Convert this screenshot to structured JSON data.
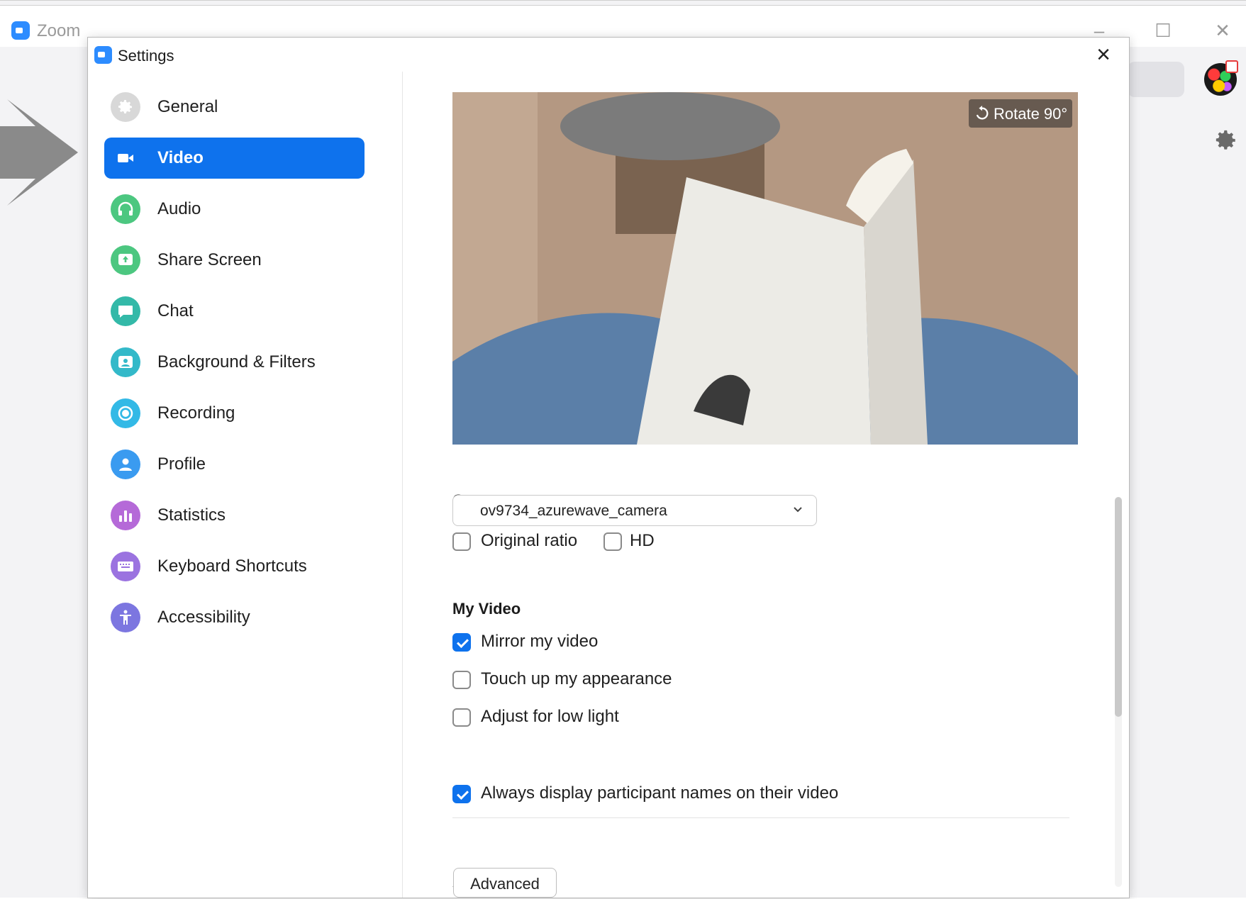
{
  "app": {
    "title": "Zoom"
  },
  "settings": {
    "title": "Settings"
  },
  "sidebar": {
    "items": [
      {
        "label": "General",
        "icon": "gear-icon",
        "color": "#d8d8d8",
        "active": false
      },
      {
        "label": "Video",
        "icon": "video-camera-icon",
        "color": "#0e72ed",
        "active": true
      },
      {
        "label": "Audio",
        "icon": "headphones-icon",
        "color": "#4cc780",
        "active": false
      },
      {
        "label": "Share Screen",
        "icon": "share-screen-icon",
        "color": "#4cc780",
        "active": false
      },
      {
        "label": "Chat",
        "icon": "chat-bubble-icon",
        "color": "#33b9a8",
        "active": false
      },
      {
        "label": "Background & Filters",
        "icon": "background-icon",
        "color": "#33b9c9",
        "active": false
      },
      {
        "label": "Recording",
        "icon": "record-icon",
        "color": "#33b9e6",
        "active": false
      },
      {
        "label": "Profile",
        "icon": "profile-icon",
        "color": "#3a9bf0",
        "active": false
      },
      {
        "label": "Statistics",
        "icon": "statistics-icon",
        "color": "#b56ad8",
        "active": false
      },
      {
        "label": "Keyboard Shortcuts",
        "icon": "keyboard-icon",
        "color": "#9b73e0",
        "active": false
      },
      {
        "label": "Accessibility",
        "icon": "accessibility-icon",
        "color": "#7c76e0",
        "active": false
      }
    ]
  },
  "video": {
    "rotate_label": "Rotate 90°",
    "camera_label": "Camera",
    "camera_value": "ov9734_azurewave_camera",
    "original_ratio": {
      "label": "Original ratio",
      "checked": false
    },
    "hd": {
      "label": "HD",
      "checked": false
    },
    "my_video_label": "My Video",
    "mirror": {
      "label": "Mirror my video",
      "checked": true
    },
    "touch_up": {
      "label": "Touch up my appearance",
      "checked": false
    },
    "low_light": {
      "label": "Adjust for low light",
      "checked": false
    },
    "always_display_names": {
      "label": "Always display participant names on their video",
      "checked": true
    },
    "advanced_label": "Advanced"
  },
  "colors": {
    "accent": "#0e72ed",
    "zoom_brand": "#2d8cff"
  }
}
